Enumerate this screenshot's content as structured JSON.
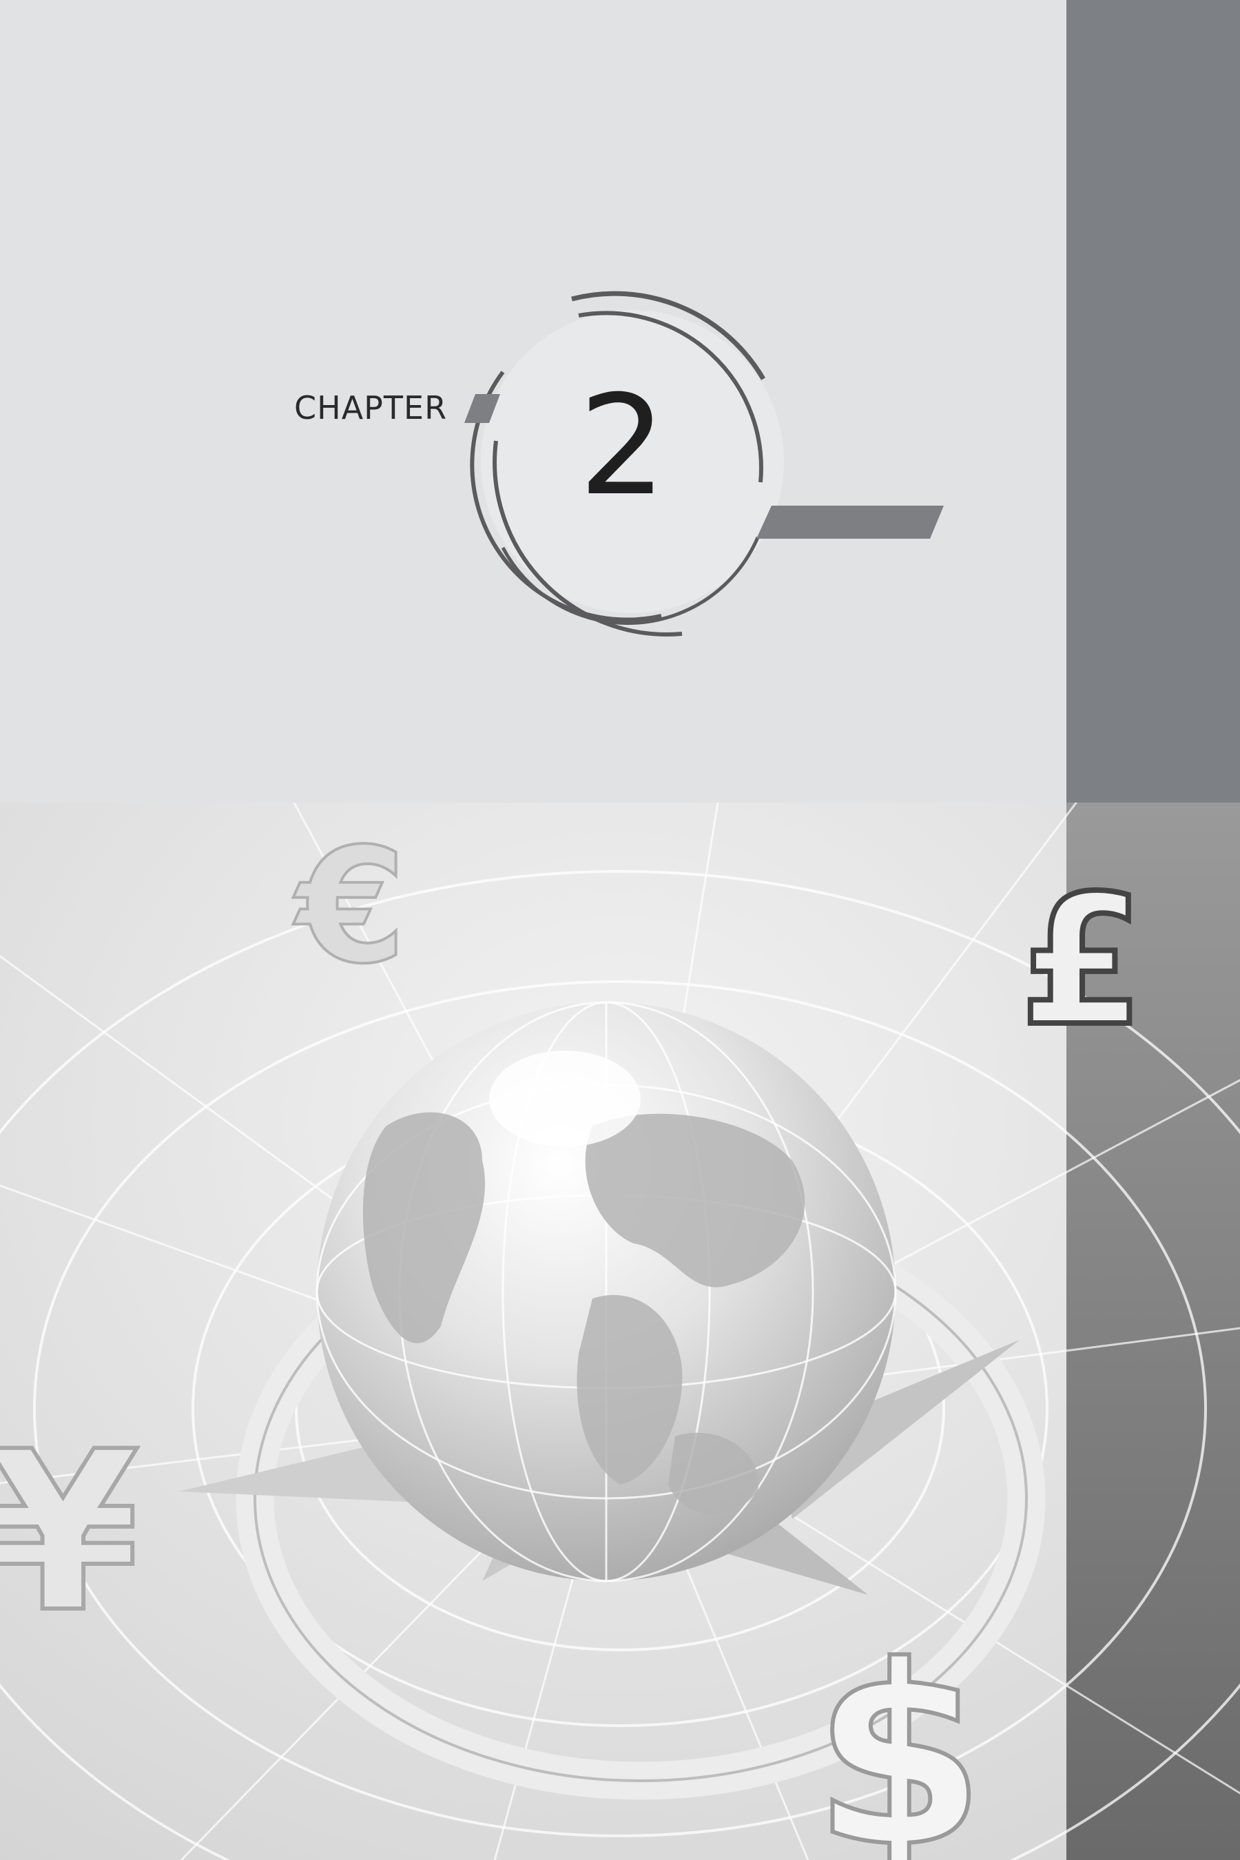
{
  "chapter": {
    "label": "CHAPTER",
    "number": "2"
  },
  "colors": {
    "page_background": "#e1e2e4",
    "side_band": "#7d8084",
    "ring_stroke": "#5b5b5e",
    "accent_bar": "#7d7f83",
    "text": "#1f1f1f"
  },
  "image": {
    "subject": "globe-with-currency-symbols",
    "symbols": [
      "€",
      "£",
      "¥",
      "$"
    ]
  }
}
